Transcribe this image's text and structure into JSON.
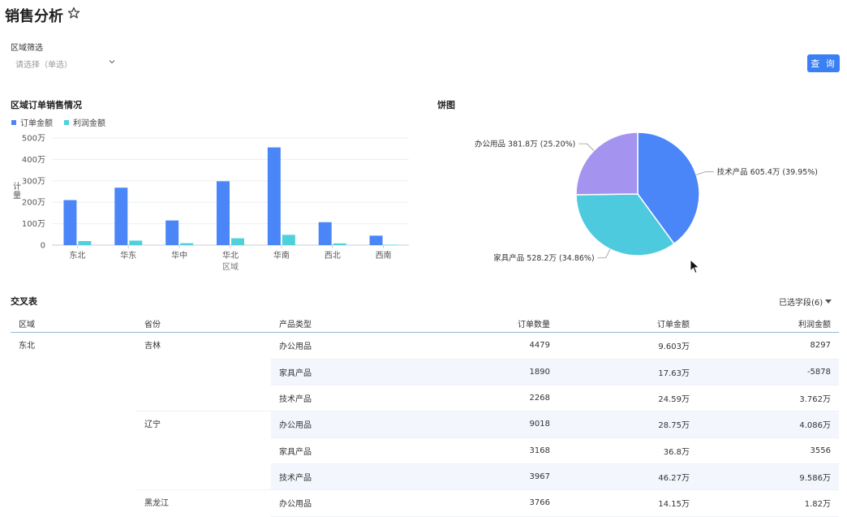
{
  "page": {
    "title": "销售分析"
  },
  "filter": {
    "label": "区域筛选",
    "placeholder": "请选择（单选）"
  },
  "query_button": "查 询",
  "bar_section": {
    "title": "区域订单销售情况",
    "legend": [
      {
        "name": "订单金额",
        "color": "#4a86f7"
      },
      {
        "name": "利润金额",
        "color": "#4fd1dc"
      }
    ]
  },
  "pie_section": {
    "title": "饼图"
  },
  "table_section": {
    "title": "交叉表",
    "fields_toggle": "已选字段(6)"
  },
  "chart_data": [
    {
      "type": "bar",
      "title": "区域订单销售情况",
      "xlabel": "区域",
      "ylabel": "计量",
      "categories": [
        "东北",
        "华东",
        "华中",
        "华北",
        "华南",
        "西北",
        "西南"
      ],
      "ylim": [
        0,
        5000000
      ],
      "yticks": [
        "0",
        "100万",
        "200万",
        "300万",
        "400万",
        "500万"
      ],
      "series": [
        {
          "name": "订单金额",
          "color": "#4a86f7",
          "values": [
            2100000,
            2680000,
            1150000,
            2980000,
            4560000,
            1070000,
            440000
          ]
        },
        {
          "name": "利润金额",
          "color": "#4fd1dc",
          "values": [
            190000,
            210000,
            90000,
            320000,
            480000,
            80000,
            20000
          ]
        }
      ],
      "legend_position": "top-left",
      "grid": true
    },
    {
      "type": "pie",
      "title": "饼图",
      "slices": [
        {
          "name": "技术产品",
          "value_label": "605.4万",
          "percent_label": "(39.95%)",
          "value": 39.95,
          "color": "#4a86f7"
        },
        {
          "name": "家具产品",
          "value_label": "528.2万",
          "percent_label": "(34.86%)",
          "value": 34.86,
          "color": "#4ecadf"
        },
        {
          "name": "办公用品",
          "value_label": "381.8万",
          "percent_label": "(25.20%)",
          "value": 25.2,
          "color": "#a593f0"
        }
      ]
    }
  ],
  "table": {
    "headers": [
      "区域",
      "省份",
      "产品类型",
      "订单数量",
      "订单金额",
      "利润金额"
    ],
    "rows": [
      [
        "东北",
        "吉林",
        "办公用品",
        "4479",
        "9.603万",
        "8297"
      ],
      [
        "",
        "",
        "家具产品",
        "1890",
        "17.63万",
        "-5878"
      ],
      [
        "",
        "",
        "技术产品",
        "2268",
        "24.59万",
        "3.762万"
      ],
      [
        "",
        "辽宁",
        "办公用品",
        "9018",
        "28.75万",
        "4.086万"
      ],
      [
        "",
        "",
        "家具产品",
        "3168",
        "36.8万",
        "3556"
      ],
      [
        "",
        "",
        "技术产品",
        "3967",
        "46.27万",
        "9.586万"
      ],
      [
        "",
        "黑龙江",
        "办公用品",
        "3766",
        "14.15万",
        "1.82万"
      ]
    ]
  }
}
